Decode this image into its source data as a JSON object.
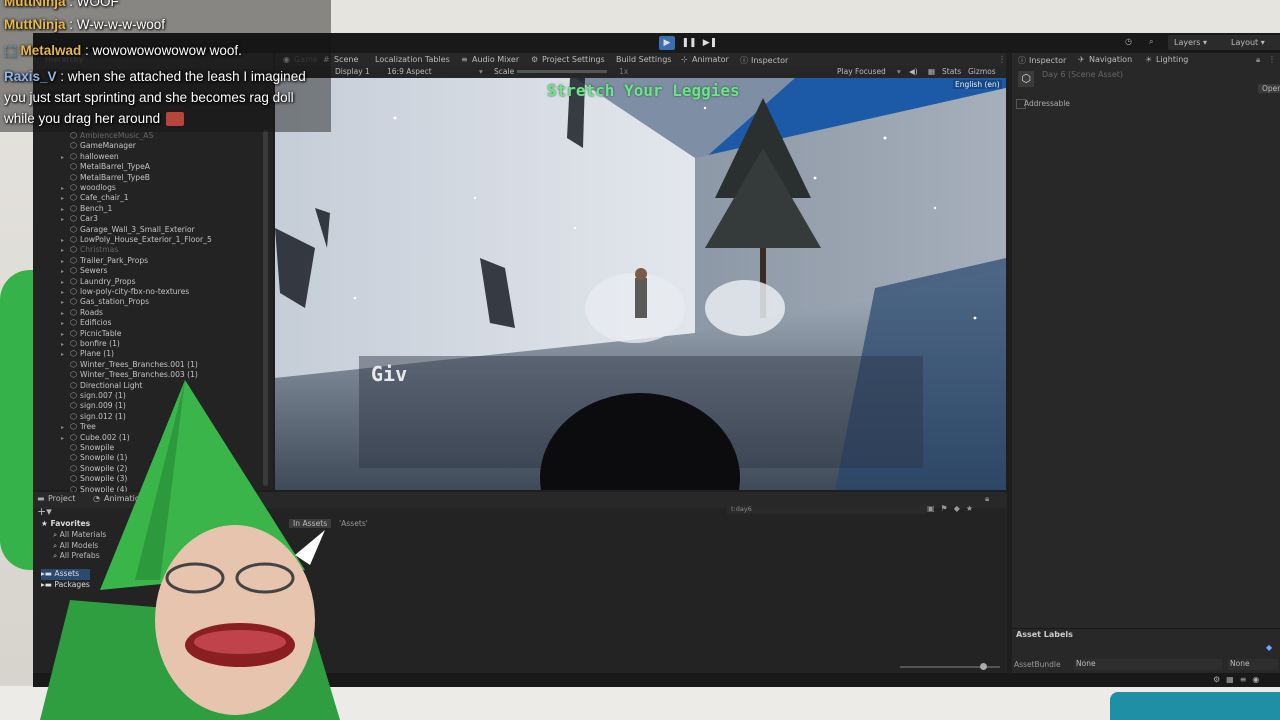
{
  "toolbar": {
    "layers_label": "Layers",
    "layout_label": "Layout"
  },
  "hierarchy": {
    "tab_label": "Hierarchy",
    "items": [
      {
        "label": "AmbienceMusic_AS",
        "dim": true,
        "fold": false
      },
      {
        "label": "GameManager",
        "dim": false,
        "fold": false
      },
      {
        "label": "halloween",
        "dim": false,
        "fold": true
      },
      {
        "label": "MetalBarrel_TypeA",
        "dim": false,
        "fold": false
      },
      {
        "label": "MetalBarrel_TypeB",
        "dim": false,
        "fold": false
      },
      {
        "label": "woodlogs",
        "dim": false,
        "fold": true
      },
      {
        "label": "Cafe_chair_1",
        "dim": false,
        "fold": true
      },
      {
        "label": "Bench_1",
        "dim": false,
        "fold": true
      },
      {
        "label": "Car3",
        "dim": false,
        "fold": true
      },
      {
        "label": "Garage_Wall_3_Small_Exterior",
        "dim": false,
        "fold": false
      },
      {
        "label": "LowPoly_House_Exterior_1_Floor_5",
        "dim": false,
        "fold": true
      },
      {
        "label": "Christmas",
        "dim": true,
        "fold": true
      },
      {
        "label": "Trailer_Park_Props",
        "dim": false,
        "fold": true
      },
      {
        "label": "Sewers",
        "dim": false,
        "fold": true
      },
      {
        "label": "Laundry_Props",
        "dim": false,
        "fold": true
      },
      {
        "label": "low-poly-city-fbx-no-textures",
        "dim": false,
        "fold": true
      },
      {
        "label": "Gas_station_Props",
        "dim": false,
        "fold": true
      },
      {
        "label": "Roads",
        "dim": false,
        "fold": true
      },
      {
        "label": "Edificios",
        "dim": false,
        "fold": true
      },
      {
        "label": "PicnicTable",
        "dim": false,
        "fold": true
      },
      {
        "label": "bonfire (1)",
        "dim": false,
        "fold": true
      },
      {
        "label": "Plane (1)",
        "dim": false,
        "fold": true
      },
      {
        "label": "Winter_Trees_Branches.001 (1)",
        "dim": false,
        "fold": false
      },
      {
        "label": "Winter_Trees_Branches.003 (1)",
        "dim": false,
        "fold": false
      },
      {
        "label": "Directional Light",
        "dim": false,
        "fold": false
      },
      {
        "label": "sign.007 (1)",
        "dim": false,
        "fold": false
      },
      {
        "label": "sign.009 (1)",
        "dim": false,
        "fold": false
      },
      {
        "label": "sign.012 (1)",
        "dim": false,
        "fold": false
      },
      {
        "label": "Tree",
        "dim": false,
        "fold": true
      },
      {
        "label": "Cube.002 (1)",
        "dim": false,
        "fold": true
      },
      {
        "label": "Snowpile",
        "dim": false,
        "fold": false
      },
      {
        "label": "Snowpile (1)",
        "dim": false,
        "fold": false
      },
      {
        "label": "Snowpile (2)",
        "dim": false,
        "fold": false
      },
      {
        "label": "Snowpile (3)",
        "dim": false,
        "fold": false
      },
      {
        "label": "Snowpile (4)",
        "dim": false,
        "fold": false
      }
    ]
  },
  "center_tabs": {
    "game": "Game",
    "scene": "Scene",
    "localization": "Localization Tables",
    "audio_mixer": "Audio Mixer",
    "project_settings": "Project Settings",
    "build_settings": "Build Settings",
    "animator": "Animator",
    "inspector": "Inspector"
  },
  "game_bar": {
    "display": "Display 1",
    "aspect": "16:9 Aspect",
    "scale_label": "Scale",
    "scale_value": "1x",
    "play_mode": "Play Focused",
    "stats": "Stats",
    "gizmos": "Gizmos"
  },
  "game_view": {
    "banner": "Stretch Your Leggies",
    "dialogue": "Giv",
    "language": "English (en)"
  },
  "inspector": {
    "tab_inspector": "Inspector",
    "tab_navigation": "Navigation",
    "tab_lighting": "Lighting",
    "asset_title": "Day 6 (Scene Asset)",
    "open_button": "Open",
    "addressable": "Addressable",
    "asset_labels": "Asset Labels",
    "asset_bundle_label": "AssetBundle",
    "asset_bundle_value": "None",
    "asset_variant_value": "None"
  },
  "project": {
    "tab_project": "Project",
    "tab_animation": "Animation",
    "favorites": "Favorites",
    "fav_items": [
      "All Materials",
      "All Models",
      "All Prefabs"
    ],
    "assets": "Assets",
    "packages": "Packages",
    "search_scope_in_assets": "In Assets",
    "search_scope_assets": "'Assets'",
    "search_text": "t:day6"
  },
  "chat": [
    {
      "user": "MuttNinja",
      "msg": " : WOOF",
      "color": "#e8b84a"
    },
    {
      "user": "MuttNinja",
      "msg": " : W-w-w-w-woof",
      "color": "#e8b84a"
    },
    {
      "user": "Metalwad",
      "msg": " : wowowowowowow woof.",
      "color": "#e8b84a"
    },
    {
      "user": "Raxis_V",
      "msg": " : when she attached the leash I imagined",
      "color": "#8fb6e8"
    },
    {
      "user": "",
      "msg": "you just start sprinting and she becomes rag doll",
      "color": "#ffffff"
    },
    {
      "user": "",
      "msg": "while you drag her around",
      "color": "#ffffff"
    }
  ],
  "colors": {
    "play_active": "#3a6fb0",
    "banner_green": "#6ee38a",
    "gnome_hat": "#39b54a"
  }
}
